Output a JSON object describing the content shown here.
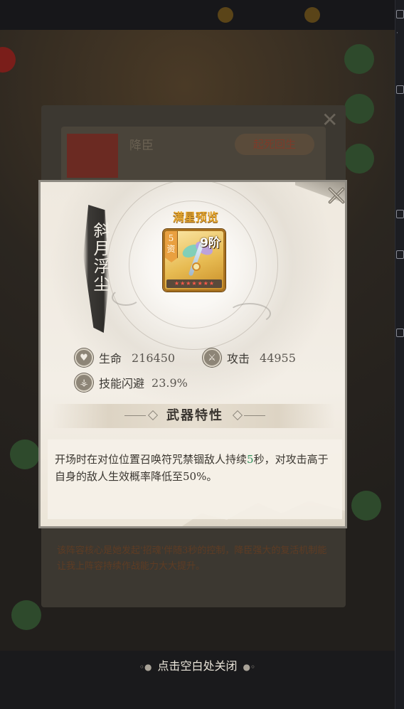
{
  "modal": {
    "hero_name": "斜月浮尘",
    "preview_title": "满星预览",
    "item": {
      "aptitude": "5资",
      "grade": "9阶",
      "stars": 7,
      "star_glyph": "★"
    },
    "stats": [
      {
        "icon": "heart-icon",
        "glyph": "♥",
        "label": "生命",
        "value": "216450"
      },
      {
        "icon": "sword-icon",
        "glyph": "⚔",
        "label": "攻击",
        "value": "44955"
      },
      {
        "icon": "dodge-icon",
        "glyph": "⚶",
        "label": "技能闪避",
        "value": "23.9%"
      }
    ],
    "section_title": "武器特性",
    "description": {
      "before": "开场时在对位位置召唤符咒禁锢敌人持续",
      "highlight": "5",
      "after": "秒，对攻击高于自身的敌人生效概率降低至50%。"
    },
    "close_icon": "close-icon"
  },
  "background": {
    "hero_tag": "降臣",
    "button": "起死回生",
    "body_text": "该阵容核心是她发起'招魂'伴随3秒的控制，降臣强大的复活机制能让我上阵容持续作战能力大大提升。"
  },
  "close_hint": {
    "text": "点击空白处关闭",
    "deco_left": "◦●",
    "deco_right": "●◦"
  },
  "colors": {
    "accent_gold": "#e4a52c",
    "highlight_green": "#2f8f5a",
    "star_red": "#ff5a4a"
  }
}
